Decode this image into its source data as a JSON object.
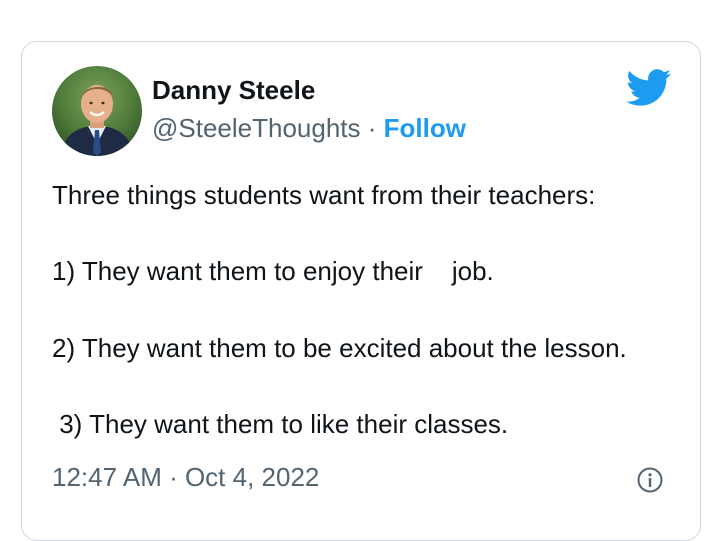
{
  "author": {
    "name": "Danny Steele",
    "handle": "@SteeleThoughts",
    "separator": " · ",
    "follow_label": "Follow",
    "avatar_icon": "profile-photo"
  },
  "brand": {
    "icon": "twitter-bird-icon",
    "color": "#1d9bf0"
  },
  "tweet": {
    "lines": [
      "Three things students want from their teachers:",
      "1) They want them to enjoy their    job.",
      "2) They want them to be excited about the lesson.",
      " 3) They want them to like their classes."
    ]
  },
  "footer": {
    "timestamp": "12:47 AM · Oct 4, 2022",
    "info_icon": "info-icon"
  }
}
